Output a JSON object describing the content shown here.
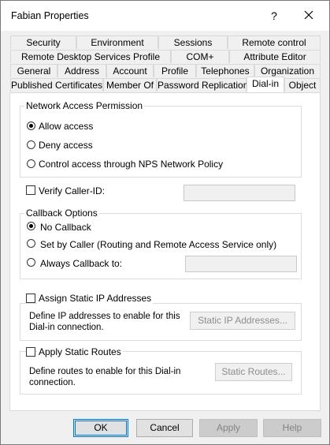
{
  "window": {
    "title": "Fabian Properties",
    "help_label": "?",
    "close_icon": "close-icon"
  },
  "tabs": {
    "row1": [
      "Security",
      "Environment",
      "Sessions",
      "Remote control"
    ],
    "row2": [
      "Remote Desktop Services Profile",
      "COM+",
      "Attribute Editor"
    ],
    "row3": [
      "General",
      "Address",
      "Account",
      "Profile",
      "Telephones",
      "Organization"
    ],
    "row4": [
      "Published Certificates",
      "Member Of",
      "Password Replication",
      "Dial-in",
      "Object"
    ],
    "active": "Dial-in"
  },
  "network_access": {
    "legend": "Network Access Permission",
    "options": [
      "Allow access",
      "Deny access",
      "Control access through NPS Network Policy"
    ],
    "selected": "Allow access"
  },
  "verify_caller_id": {
    "label": "Verify Caller-ID:",
    "value": ""
  },
  "callback": {
    "legend": "Callback Options",
    "options": [
      "No Callback",
      "Set by Caller (Routing and Remote Access Service only)",
      "Always Callback to:"
    ],
    "selected": "No Callback",
    "callback_number": ""
  },
  "static_ip": {
    "label": "Assign Static IP Addresses",
    "description_line1": "Define IP addresses to enable for this",
    "description_line2": "Dial-in connection.",
    "button": "Static IP Addresses..."
  },
  "static_routes": {
    "label": "Apply Static Routes",
    "description_line1": "Define routes to enable for this Dial-in",
    "description_line2": "connection.",
    "button": "Static Routes..."
  },
  "footer": {
    "ok": "OK",
    "cancel": "Cancel",
    "apply": "Apply",
    "help": "Help"
  }
}
